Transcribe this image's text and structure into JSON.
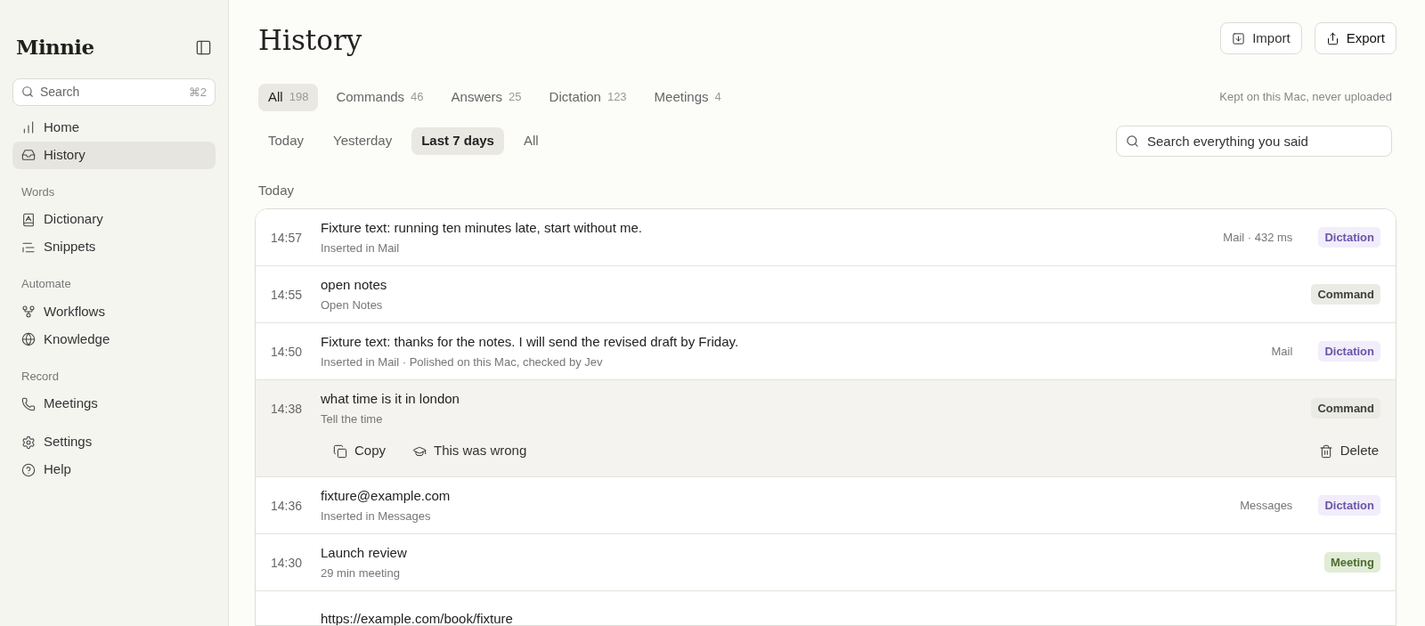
{
  "sidebar": {
    "logo": "Minnie",
    "search": {
      "placeholder": "Search",
      "shortcut": "⌘2"
    },
    "sections": [
      {
        "items": [
          {
            "label": "Home",
            "selected": false
          },
          {
            "label": "History",
            "selected": true
          }
        ]
      },
      {
        "heading": "Words",
        "items": [
          {
            "label": "Dictionary",
            "selected": false
          },
          {
            "label": "Snippets",
            "selected": false
          }
        ]
      },
      {
        "heading": "Automate",
        "items": [
          {
            "label": "Workflows",
            "selected": false
          },
          {
            "label": "Knowledge",
            "selected": false
          }
        ]
      },
      {
        "heading": "Record",
        "items": [
          {
            "label": "Meetings",
            "selected": false
          }
        ]
      },
      {
        "items": [
          {
            "label": "Settings",
            "selected": false
          },
          {
            "label": "Help",
            "selected": false
          }
        ]
      }
    ]
  },
  "header": {
    "title": "History",
    "buttons": [
      {
        "kind": "import",
        "label": "Import"
      },
      {
        "kind": "export",
        "label": "Export"
      }
    ]
  },
  "type_tabs": [
    {
      "label": "All",
      "count": "198",
      "selected": true
    },
    {
      "label": "Commands",
      "count": "46",
      "selected": false
    },
    {
      "label": "Answers",
      "count": "25",
      "selected": false
    },
    {
      "label": "Dictation",
      "count": "123",
      "selected": false
    },
    {
      "label": "Meetings",
      "count": "4",
      "selected": false
    }
  ],
  "privacy_note": "Kept on this Mac, never uploaded",
  "range_tabs": [
    {
      "label": "Today",
      "selected": false
    },
    {
      "label": "Yesterday",
      "selected": false
    },
    {
      "label": "Last 7 days",
      "selected": true
    },
    {
      "label": "All",
      "selected": false
    }
  ],
  "search": {
    "placeholder": "Search everything you said"
  },
  "group_heading": "Today",
  "rows": [
    {
      "time": "14:57",
      "title": "Fixture text: running ten minutes late, start without me.",
      "subtitle": "Inserted in Mail",
      "meta": "Mail · 432 ms",
      "badge": {
        "label": "Dictation",
        "kind": "dictation"
      },
      "expanded": false
    },
    {
      "time": "14:55",
      "title": "open notes",
      "subtitle": "Open Notes",
      "badge": {
        "label": "Command",
        "kind": "command"
      },
      "expanded": false
    },
    {
      "time": "14:50",
      "title": "Fixture text: thanks for the notes. I will send the revised draft by Friday.",
      "subtitle": "Inserted in Mail · Polished on this Mac, checked by Jev",
      "meta": "Mail",
      "badge": {
        "label": "Dictation",
        "kind": "dictation"
      },
      "expanded": false
    },
    {
      "time": "14:38",
      "title": "what time is it in london",
      "subtitle": "Tell the time",
      "badge": {
        "label": "Command",
        "kind": "command"
      },
      "expanded": true,
      "actions": [
        {
          "kind": "copy",
          "label": "Copy"
        },
        {
          "kind": "wrong",
          "label": "This was wrong"
        },
        {
          "kind": "delete",
          "label": "Delete"
        }
      ]
    },
    {
      "time": "14:36",
      "title": "fixture@example.com",
      "subtitle": "Inserted in Messages",
      "meta": "Messages",
      "badge": {
        "label": "Dictation",
        "kind": "dictation"
      },
      "expanded": false
    },
    {
      "time": "14:30",
      "title": "Launch review",
      "subtitle": "29 min meeting",
      "badge": {
        "label": "Meeting",
        "kind": "meeting"
      },
      "expanded": false
    },
    {
      "title": "https://example.com/book/fixture",
      "expanded": false
    }
  ]
}
